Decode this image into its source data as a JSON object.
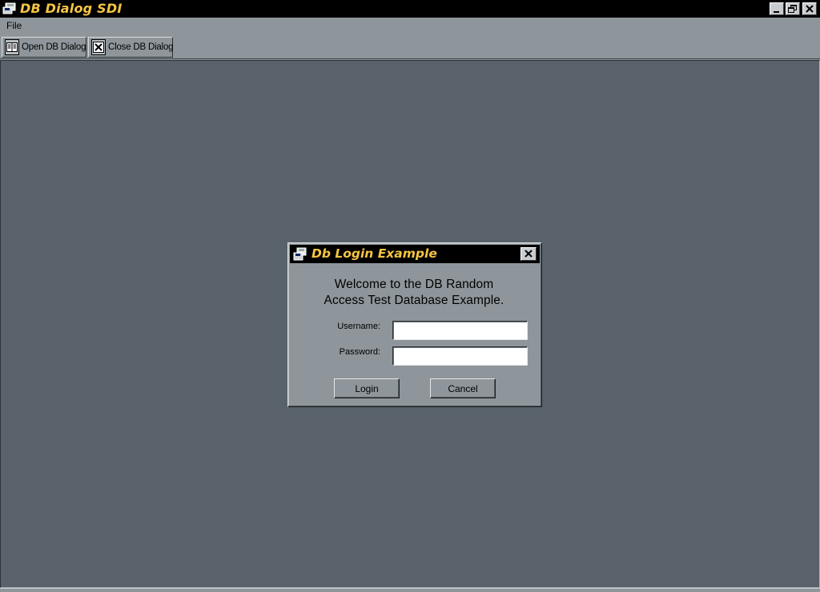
{
  "window": {
    "title": "DB Dialog SDI",
    "title_color": "#f5c542",
    "icons": {
      "app": "database-floppy-icon",
      "minimize": "minimize-icon",
      "restore": "restore-icon",
      "close": "close-icon"
    }
  },
  "menubar": {
    "items": [
      {
        "label": "File"
      }
    ]
  },
  "toolbar": {
    "buttons": [
      {
        "label": "Open DB Dialog",
        "icon": "open-book-icon"
      },
      {
        "label": "Close DB Dialog",
        "icon": "x-mark-icon"
      }
    ]
  },
  "dialog": {
    "title": "Db Login Example",
    "icon": "database-floppy-icon",
    "welcome_line1": "Welcome to the DB Random",
    "welcome_line2": "Access Test Database Example.",
    "username_label": "Username:",
    "username_value": "",
    "password_label": "Password:",
    "password_value": "",
    "login_label": "Login",
    "cancel_label": "Cancel"
  },
  "colors": {
    "chrome": "#8e969b",
    "workspace": "#59626a",
    "titlebar": "#000000",
    "title_text": "#f5c542"
  }
}
